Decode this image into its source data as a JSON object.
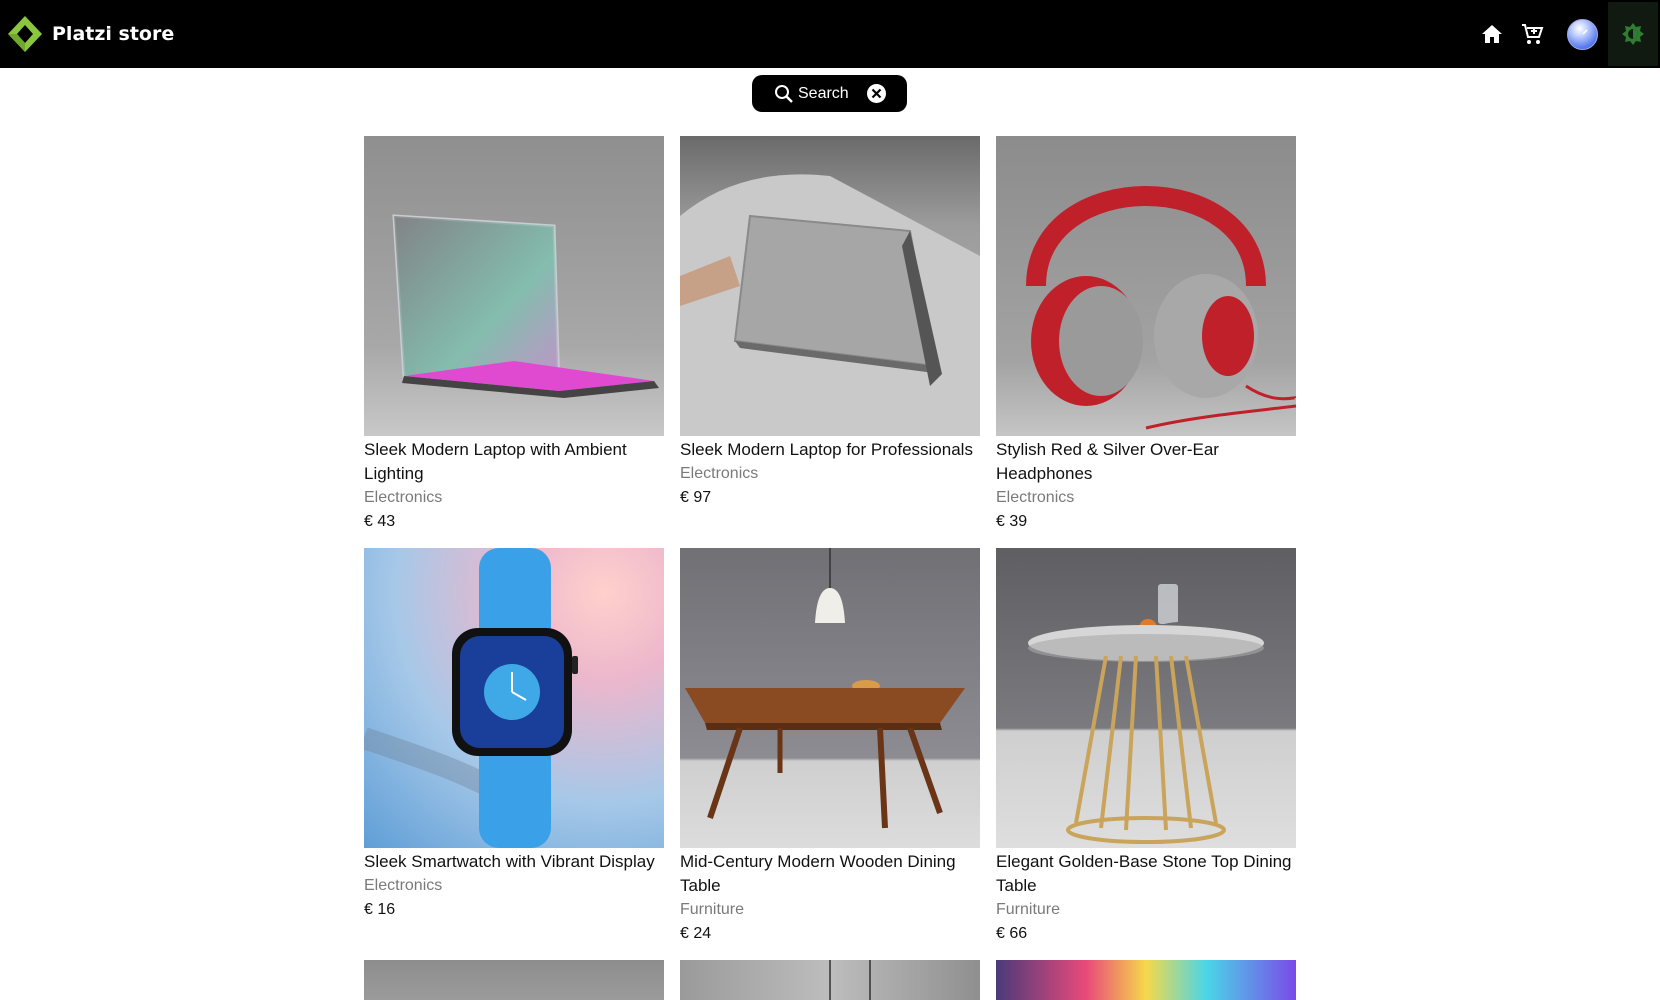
{
  "header": {
    "brand": "Platzi store",
    "icons": [
      "diamond-logo-icon",
      "home-icon",
      "cart-icon",
      "avatar",
      "sun-icon"
    ]
  },
  "search": {
    "label": "Search"
  },
  "products": [
    {
      "title": "Sleek Modern Laptop with Ambient Lighting",
      "category": "Electronics",
      "price": "€ 43"
    },
    {
      "title": "Sleek Modern Laptop for Professionals",
      "category": "Electronics",
      "price": "€ 97"
    },
    {
      "title": "Stylish Red & Silver Over-Ear Headphones",
      "category": "Electronics",
      "price": "€ 39"
    },
    {
      "title": "Sleek Smartwatch with Vibrant Display",
      "category": "Electronics",
      "price": "€ 16"
    },
    {
      "title": "Mid-Century Modern Wooden Dining Table",
      "category": "Furniture",
      "price": "€ 24"
    },
    {
      "title": "Elegant Golden-Base Stone Top Dining Table",
      "category": "Furniture",
      "price": "€ 66"
    }
  ],
  "colors": {
    "header_bg": "#000000",
    "brand_green": "#8cc63f",
    "theme_green": "#2e7d32",
    "category_gray": "#7a7a7a"
  }
}
